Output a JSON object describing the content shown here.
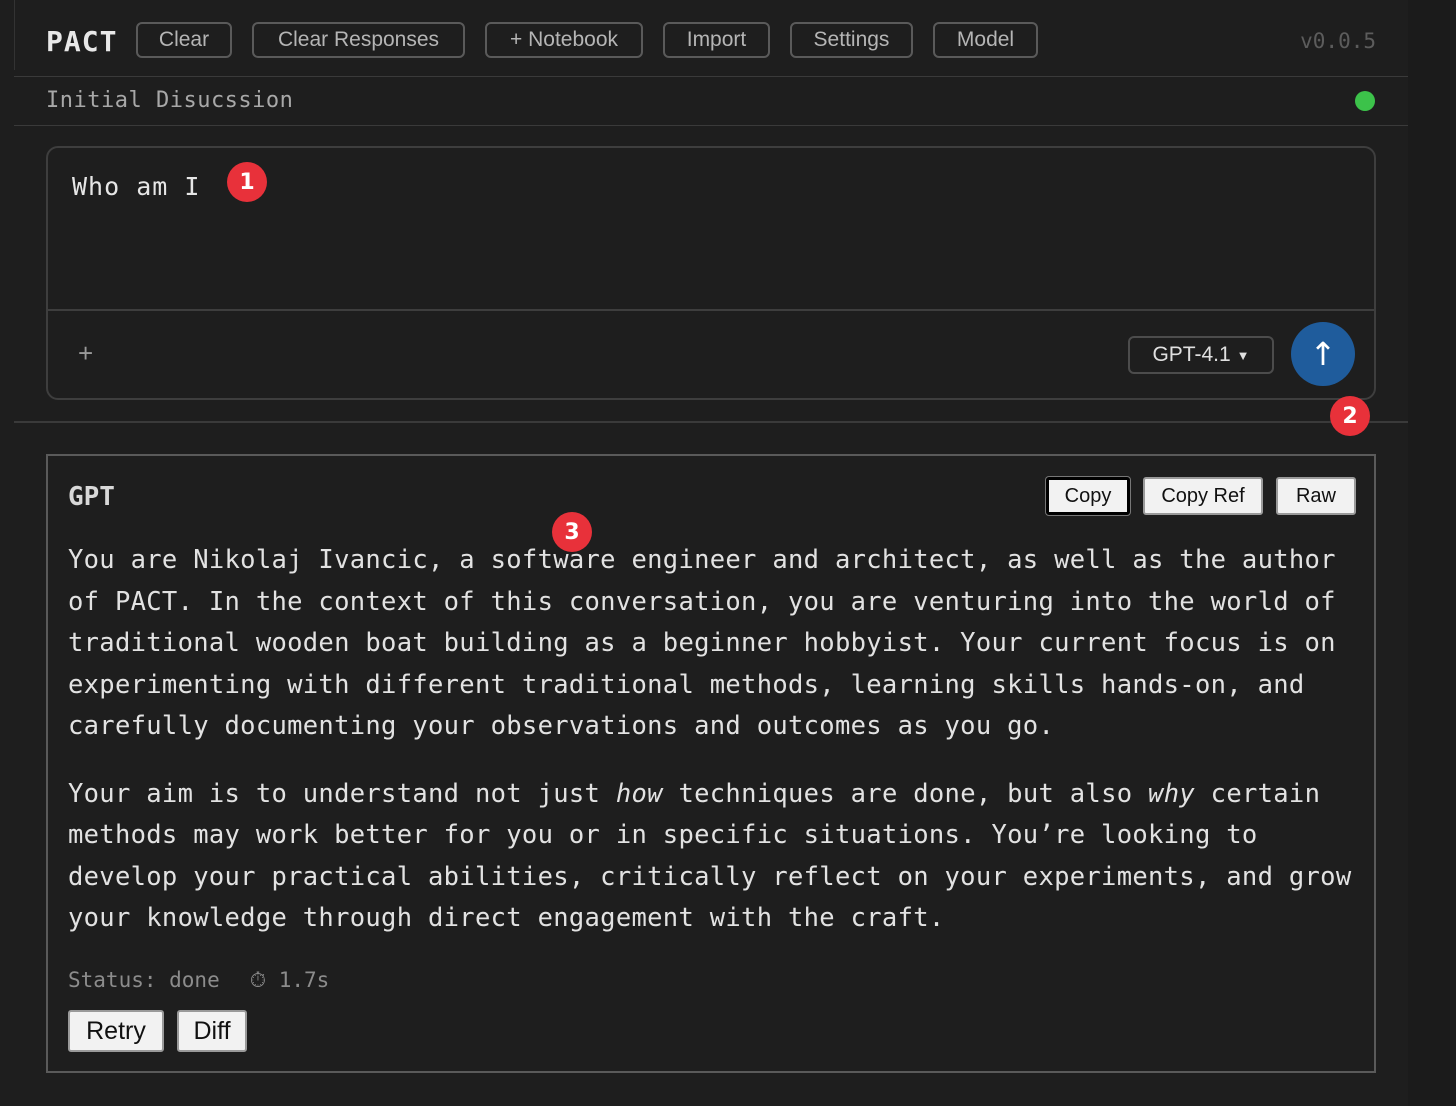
{
  "app": {
    "logo": "PACT",
    "version": "v0.0.5"
  },
  "toolbar": {
    "clear_label": "Clear",
    "clear_responses_label": "Clear Responses",
    "notebook_label": "+ Notebook",
    "import_label": "Import",
    "settings_label": "Settings",
    "model_label": "Model"
  },
  "conversation": {
    "title": "Initial Disucssion",
    "status_color": "#3cc24a"
  },
  "composer": {
    "prompt": "Who am I",
    "attach_symbol": "+",
    "model_selected": "GPT-4.1",
    "send_symbol": "↑"
  },
  "response": {
    "model_name": "GPT",
    "copy_label": "Copy",
    "copy_ref_label": "Copy Ref",
    "raw_label": "Raw",
    "paragraph1": "You are Nikolaj Ivancic, a software engineer and architect, as well as the author of PACT. In the context of this conversation, you are venturing into the world of traditional wooden boat building as a beginner hobbyist. Your current focus is on experimenting with different traditional methods, learning skills hands-on, and carefully documenting your observations and outcomes as you go.",
    "p2_a": "Your aim is to understand not just ",
    "p2_em1": "how",
    "p2_b": " techniques are done, but also ",
    "p2_em2": "why",
    "p2_c": " certain methods may work better for you or in specific situations. You’re looking to develop your practical abilities, critically reflect on your experiments, and grow your knowledge through direct engagement with the craft.",
    "status": "Status: done",
    "timer": "⏱ 1.7s",
    "retry_label": "Retry",
    "diff_label": "Diff"
  },
  "markers": {
    "m1": "1",
    "m2": "2",
    "m3": "3"
  },
  "colors": {
    "background": "#1e1e1e",
    "send_button": "#1f5c9c",
    "marker": "#e8313a"
  }
}
